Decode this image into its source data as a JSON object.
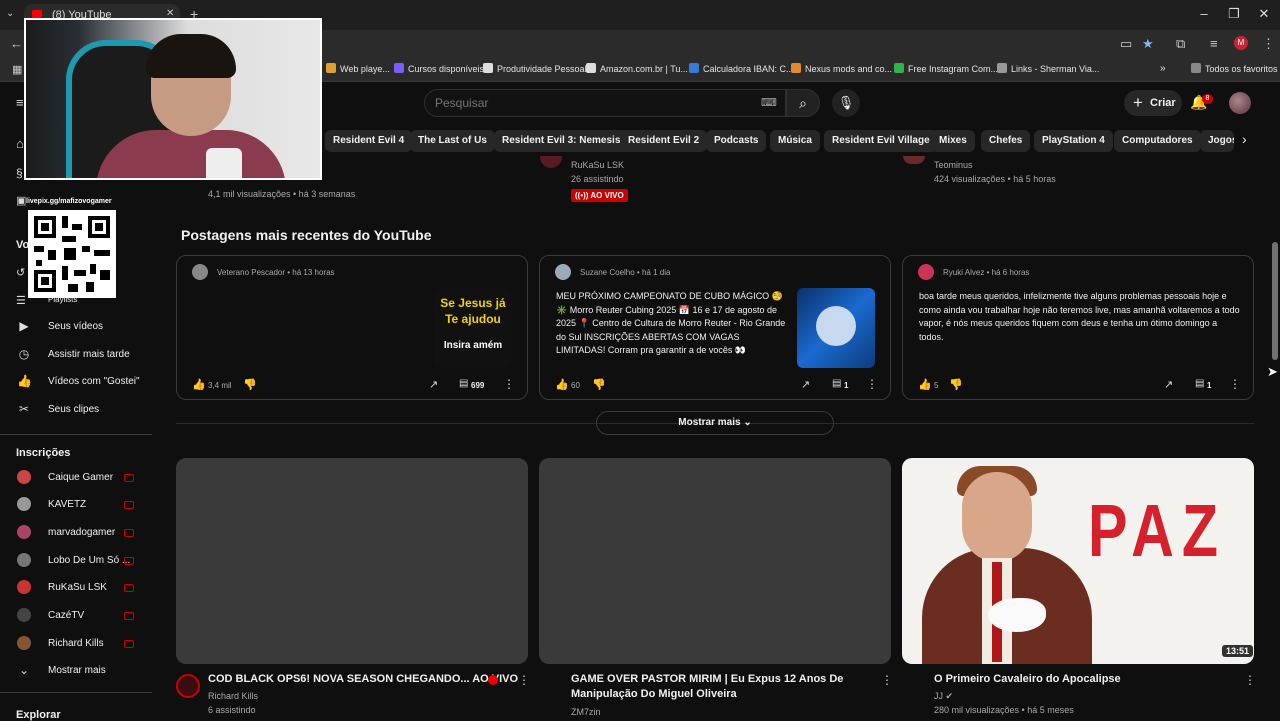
{
  "browser": {
    "tab_title": "(8) YouTube",
    "bookmarks": [
      {
        "label": "Web playe...",
        "color": "#e0a030"
      },
      {
        "label": "Cursos disponíveis",
        "color": "#7b5cff"
      },
      {
        "label": "Produtividade Pessoal",
        "color": "#dddddd"
      },
      {
        "label": "Amazon.com.br | Tu...",
        "color": "#dddddd"
      },
      {
        "label": "Calculadora IBAN: C...",
        "color": "#3b7bd8"
      },
      {
        "label": "Nexus mods and co...",
        "color": "#e28a2e"
      },
      {
        "label": "Free Instagram Com...",
        "color": "#2fb34a"
      },
      {
        "label": "Links - Sherman Via...",
        "color": "#999999"
      },
      {
        "label": "Todos os favoritos",
        "color": "#888888"
      }
    ]
  },
  "header": {
    "search_placeholder": "Pesquisar",
    "create_label": "Criar",
    "notification_count": "8"
  },
  "chips": [
    "Resident Evil 4",
    "The Last of Us",
    "Resident Evil 3: Nemesis",
    "Resident Evil 2",
    "Podcasts",
    "Música",
    "Resident Evil Village",
    "Mixes",
    "Chefes",
    "PlayStation 4",
    "Computadores",
    "Jogos d"
  ],
  "top_row": {
    "left_meta": "4,1 mil visualizações • há 3 semanas",
    "mid_channel": "RuKaSu LSK",
    "mid_meta": "26 assistindo",
    "mid_badge": "AO VIVO",
    "right_channel": "Teominus",
    "right_meta": "424 visualizações • há 5 horas"
  },
  "overlay": {
    "livepix": "livepix.gg/mafizovogamer"
  },
  "sidebar": {
    "partial_a": "Vo",
    "partial_b": "Playlists",
    "items": [
      {
        "label": "Seus vídeos",
        "icon": "video-icon"
      },
      {
        "label": "Assistir mais tarde",
        "icon": "clock-icon"
      },
      {
        "label": "Vídeos com \"Gostei\"",
        "icon": "thumb-up-icon"
      },
      {
        "label": "Seus clipes",
        "icon": "scissors-icon"
      }
    ],
    "subs_heading": "Inscrições",
    "subscriptions": [
      {
        "label": "Caique Gamer",
        "color": "#c44"
      },
      {
        "label": "KAVETZ",
        "color": "#999"
      },
      {
        "label": "marvadogamer",
        "color": "#a46"
      },
      {
        "label": "Lobo De Um Só ...",
        "color": "#777"
      },
      {
        "label": "RuKaSu LSK",
        "color": "#c33"
      },
      {
        "label": "CazéTV",
        "color": "#444"
      },
      {
        "label": "Richard Kills",
        "color": "#853"
      }
    ],
    "show_more": "Mostrar mais",
    "explore_heading": "Explorar"
  },
  "posts": {
    "title": "Postagens mais recentes do YouTube",
    "cards": [
      {
        "author": "Veterano Pescador • há 13 horas",
        "text": "",
        "likes": "3,4 mil",
        "comments": "699",
        "avatar_color": "#888",
        "image": "Se Jesus já Te ajudou | Insira amém"
      },
      {
        "author": "Suzane Coelho • há 1 dia",
        "text": "MEU PRÓXIMO CAMPEONATO DE CUBO MÁGICO 🧐 ✳️ Morro Reuter Cubing 2025 📅 16 e 17 de agosto de 2025 📍 Centro de Cultura de Morro Reuter - Rio Grande do Sul INSCRIÇÕES ABERTAS COM VAGAS LIMITADAS! Corram pra garantir a de vocês 👀 inscrições devem...",
        "likes": "60",
        "comments": "1",
        "avatar_color": "#9ab"
      },
      {
        "author": "Ryuki Alvez • há 6 horas",
        "text": "boa tarde meus queridos, infelizmente tive alguns problemas pessoais hoje e como ainda vou trabalhar hoje não teremos live, mas amanhã voltaremos a todo vapor, é nós meus queridos fiquem com deus e tenha um ótimo domingo a todos.",
        "likes": "5",
        "comments": "1",
        "avatar_color": "#c35"
      }
    ],
    "show_more": "Mostrar mais"
  },
  "post_image": {
    "line1": "Se Jesus já",
    "line2": "Te ajudou",
    "line3": "Insira amém"
  },
  "videos": [
    {
      "title": "COD BLACK OPS6! NOVA SEASON CHEGANDO... AO VIVO",
      "channel": "Richard Kills",
      "meta": "6 assistindo",
      "avatar_color": "#3a0b10"
    },
    {
      "title": "GAME OVER PASTOR MIRIM | Eu Expus 12 Anos De Manipulação Do Miguel Oliveira",
      "channel": "ZM7zin",
      "meta": ""
    },
    {
      "title": "O Primeiro Cavaleiro do Apocalipse",
      "channel": "JJ",
      "meta": "280 mil visualizações • há 5 meses",
      "duration": "13:51",
      "thumb_text": "PAZ"
    }
  ]
}
